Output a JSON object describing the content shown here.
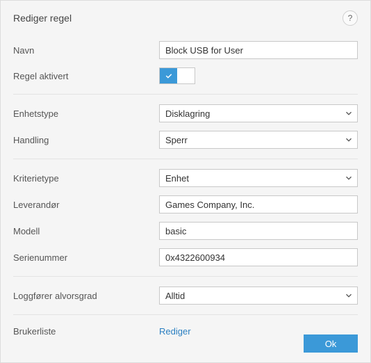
{
  "header": {
    "title": "Rediger regel",
    "help_tooltip": "?"
  },
  "fields": {
    "name_label": "Navn",
    "name_value": "Block USB for User",
    "enabled_label": "Regel aktivert",
    "enabled_value": true,
    "device_type_label": "Enhetstype",
    "device_type_value": "Disklagring",
    "action_label": "Handling",
    "action_value": "Sperr",
    "criteria_type_label": "Kriterietype",
    "criteria_type_value": "Enhet",
    "vendor_label": "Leverandør",
    "vendor_value": "Games Company, Inc.",
    "model_label": "Modell",
    "model_value": "basic",
    "serial_label": "Serienummer",
    "serial_value": "0x4322600934",
    "severity_label": "Loggfører alvorsgrad",
    "severity_value": "Alltid",
    "userlist_label": "Brukerliste",
    "userlist_link": "Rediger"
  },
  "footer": {
    "ok_label": "Ok"
  }
}
